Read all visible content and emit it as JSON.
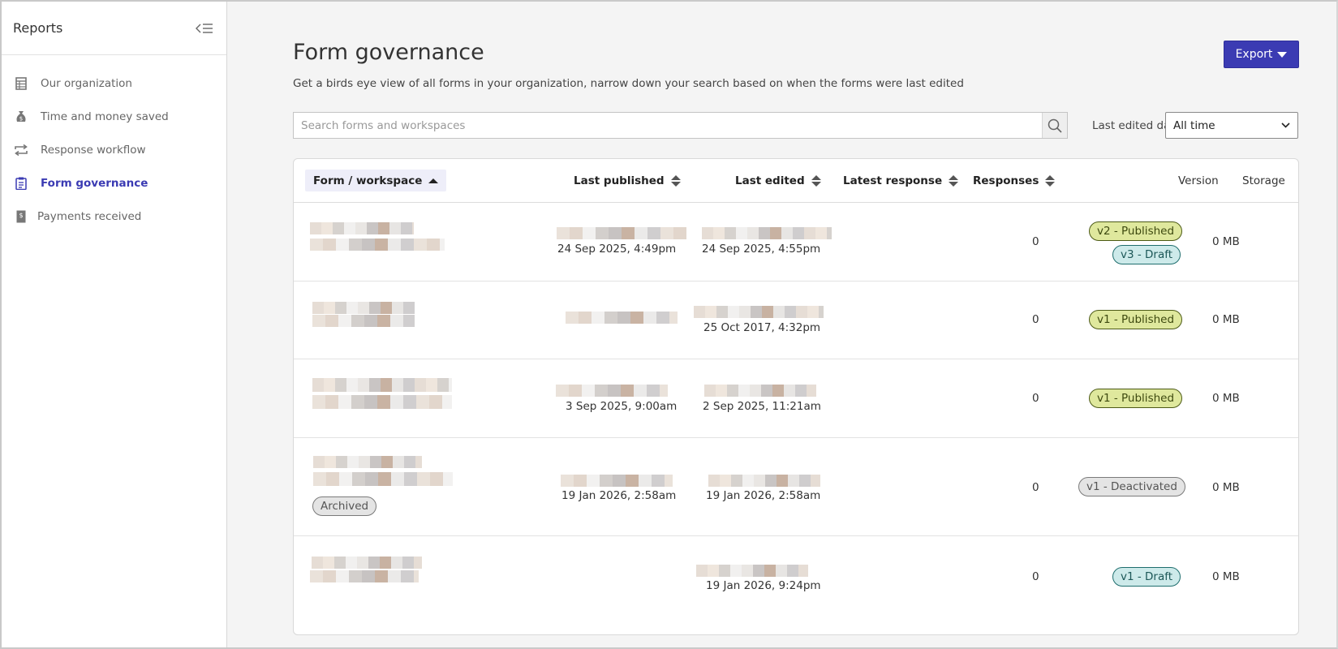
{
  "sidebar": {
    "title": "Reports",
    "items": [
      {
        "label": "Our organization",
        "icon": "table-icon"
      },
      {
        "label": "Time and money saved",
        "icon": "money-bag-icon"
      },
      {
        "label": "Response workflow",
        "icon": "workflow-arrows-icon"
      },
      {
        "label": "Form governance",
        "icon": "clipboard-icon",
        "active": true
      },
      {
        "label": "Payments received",
        "icon": "payment-receipt-icon"
      }
    ]
  },
  "header": {
    "title": "Form governance",
    "subtitle": "Get a birds eye view of all forms in your organization, narrow down your search based on when the forms were last edited",
    "export_label": "Export"
  },
  "search": {
    "placeholder": "Search forms and workspaces"
  },
  "filter": {
    "label": "Last edited date",
    "selected": "All time"
  },
  "table": {
    "columns": {
      "form": "Form / workspace",
      "last_published": "Last published",
      "last_edited": "Last edited",
      "latest_response": "Latest response",
      "responses": "Responses",
      "version": "Version",
      "storage": "Storage"
    },
    "rows": [
      {
        "last_published": "24 Sep 2025, 4:49pm",
        "last_edited": "24 Sep 2025, 4:55pm",
        "latest_response": "",
        "responses": "0",
        "versions": [
          {
            "label": "v2 - Published",
            "status": "published"
          },
          {
            "label": "v3 - Draft",
            "status": "draft"
          }
        ],
        "storage": "0 MB"
      },
      {
        "last_published": "",
        "last_edited": "25 Oct 2017, 4:32pm",
        "latest_response": "",
        "responses": "0",
        "versions": [
          {
            "label": "v1 - Published",
            "status": "published"
          }
        ],
        "storage": "0 MB"
      },
      {
        "last_published": "3 Sep 2025, 9:00am",
        "last_edited": "2 Sep 2025, 11:21am",
        "latest_response": "",
        "responses": "0",
        "versions": [
          {
            "label": "v1 - Published",
            "status": "published"
          }
        ],
        "storage": "0 MB"
      },
      {
        "archived_label": "Archived",
        "last_published": "19 Jan 2026, 2:58am",
        "last_edited": "19 Jan 2026, 2:58am",
        "latest_response": "",
        "responses": "0",
        "versions": [
          {
            "label": "v1 - Deactivated",
            "status": "deactivated"
          }
        ],
        "storage": "0 MB"
      },
      {
        "last_published": "",
        "last_edited": "19 Jan 2026, 9:24pm",
        "latest_response": "",
        "responses": "0",
        "versions": [
          {
            "label": "v1 - Draft",
            "status": "draft"
          }
        ],
        "storage": "0 MB"
      }
    ]
  },
  "colors": {
    "accent": "#3b3bb3",
    "published_bg": "#dfe89d",
    "draft_bg": "#cdeaea",
    "deactivated_bg": "#e4e4e4"
  }
}
